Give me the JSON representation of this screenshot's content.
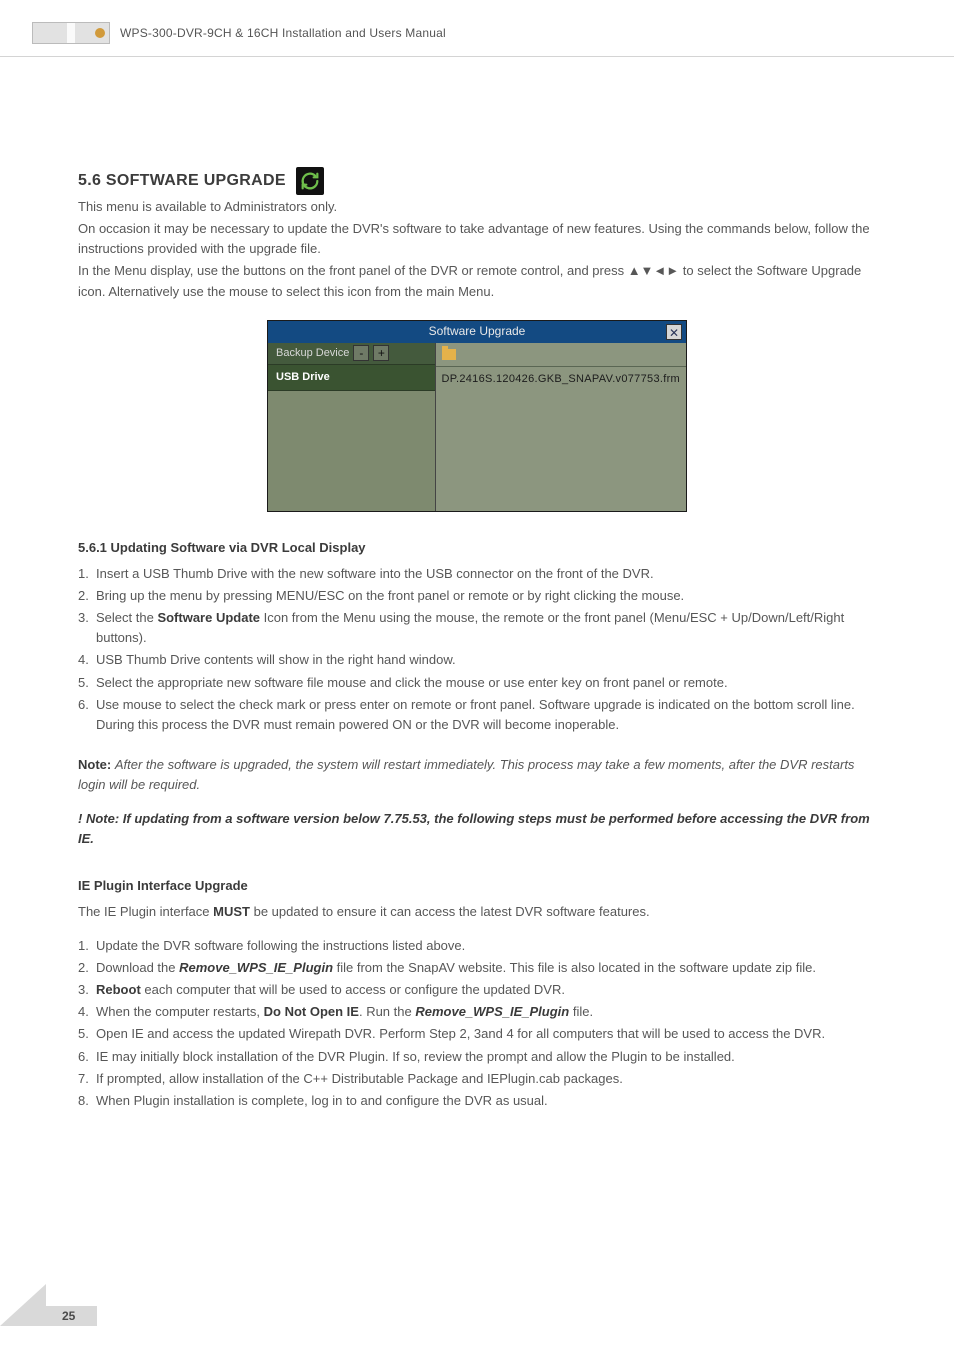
{
  "header": {
    "title": "WPS-300-DVR-9CH & 16CH Installation and Users Manual"
  },
  "section": {
    "heading": "5.6 SOFTWARE UPGRADE",
    "intro1": "This menu is available to Administrators only.",
    "intro2": "On occasion it may be necessary to update the DVR's software to take advantage of new features. Using the commands below, follow the instructions provided with the upgrade file.",
    "intro3": "In the Menu display, use the buttons on the front panel of the DVR or remote control, and press ▲▼◄► to select the Software Upgrade icon. Alternatively use the mouse to select this icon from the main Menu."
  },
  "shot": {
    "title": "Software Upgrade",
    "backup_label": "Backup Device",
    "minus": "-",
    "plus": "+",
    "left_item": "USB Drive",
    "file_label": "DP.2416S.120426.GKB_SNAPAV.v077753.frm"
  },
  "sub1_heading": "5.6.1 Updating Software via DVR Local Display",
  "list1": {
    "1": "Insert a USB Thumb Drive with the new software into the USB connector on the front of the DVR.",
    "2": "Bring up the menu by pressing MENU/ESC on the front panel or remote or by right clicking the mouse.",
    "3a": "Select the ",
    "3b": "Software Update",
    "3c": " Icon from the Menu using the mouse, the remote or the front panel (Menu/ESC + Up/Down/Left/Right buttons).",
    "4": "USB Thumb Drive contents will show in the right hand window.",
    "5": "Select the appropriate new software file mouse and click the mouse or use enter key on front panel  or remote.",
    "6": "Use mouse to select the check mark or press enter on remote or front panel. Software upgrade is indicated on the bottom scroll line.  During this process the DVR must remain powered ON or the DVR will become inoperable."
  },
  "note1": {
    "label": "Note: ",
    "text": "After the software is upgraded, the system will restart immediately. This process may take a few moments, after the DVR restarts login will be required."
  },
  "note2": "! Note: If updating from a software version below 7.75.53, the following steps must be performed before accessing the DVR from IE.",
  "sub2_heading": "IE Plugin Interface Upgrade",
  "sub2_intro": {
    "a": "The IE Plugin interface ",
    "b": "MUST",
    "c": " be updated to ensure it can access the latest DVR software features."
  },
  "list2": {
    "1": "Update the DVR software following the instructions listed above.",
    "2a": "Download the ",
    "2b": "Remove_WPS_IE_Plugin",
    "2c": " file from the SnapAV website.  This file is also located in the software update zip file.",
    "3a": "Reboot",
    "3b": " each computer that will be used to access or configure the updated DVR.",
    "4a": "When the computer restarts, ",
    "4b": "Do Not Open IE",
    "4c": ". Run the ",
    "4d": "Remove_WPS_IE_Plugin",
    "4e": " file.",
    "5": "Open IE and access the updated Wirepath DVR.  Perform Step 2, 3and 4 for all computers that will be used to access the DVR.",
    "6": "IE may initially block installation of the DVR Plugin. If so, review the prompt and allow the Plugin to be installed.",
    "7": "If prompted, allow installation of the C++ Distributable Package and IEPlugin.cab packages.",
    "8": "When Plugin installation is complete, log in to and configure the DVR as usual."
  },
  "page_number": "25"
}
